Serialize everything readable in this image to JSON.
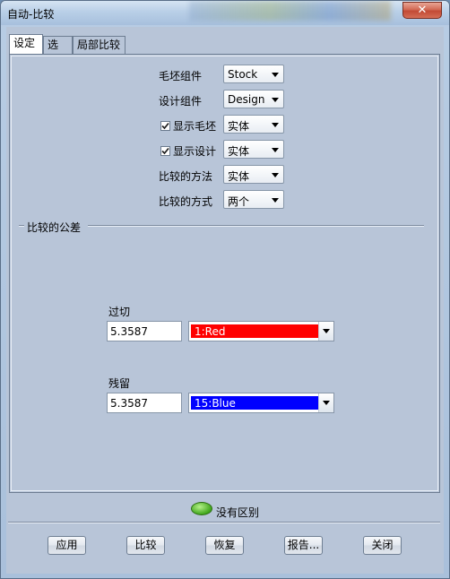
{
  "window": {
    "title": "自动-比较",
    "close_glyph": "✕"
  },
  "tabs": [
    {
      "label": "设定",
      "active": true
    },
    {
      "label": "选项",
      "active": false
    },
    {
      "label": "局部比较",
      "active": false
    }
  ],
  "settings": {
    "stock_component": {
      "label": "毛坯组件",
      "value": "Stock"
    },
    "design_component": {
      "label": "设计组件",
      "value": "Design"
    },
    "show_stock": {
      "label": "显示毛坯",
      "checked": true,
      "value": "实体"
    },
    "show_design": {
      "label": "显示设计",
      "checked": true,
      "value": "实体"
    },
    "compare_method": {
      "label": "比较的方法",
      "value": "实体"
    },
    "compare_mode": {
      "label": "比较的方式",
      "value": "两个"
    }
  },
  "tolerance": {
    "group_label": "比较的公差",
    "gouge": {
      "label": "过切",
      "value": "5.3587",
      "color_label": "1:Red",
      "color": "#ff0000"
    },
    "excess": {
      "label": "残留",
      "value": "5.3587",
      "color_label": "15:Blue",
      "color": "#0000ff"
    }
  },
  "status": {
    "text": "没有区别",
    "color": "#3fa61b"
  },
  "buttons": {
    "apply": "应用",
    "compare": "比较",
    "restore": "恢复",
    "report": "报告...",
    "close": "关闭"
  }
}
